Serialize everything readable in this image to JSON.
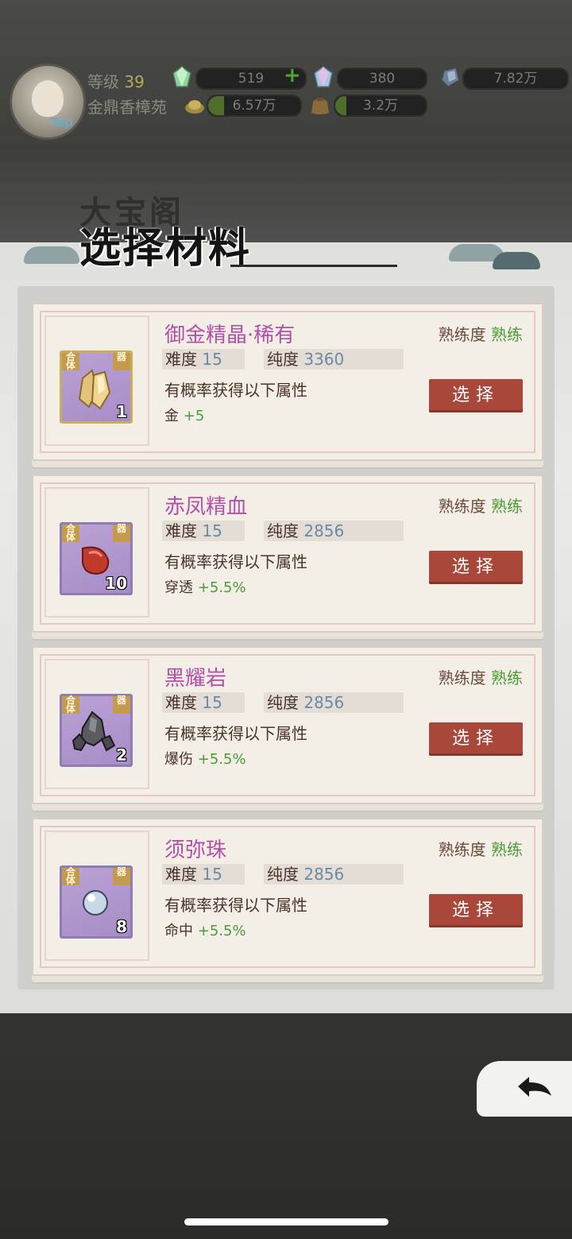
{
  "header": {
    "level_label": "等级",
    "level_value": "39",
    "place_name": "金鼎香樟苑",
    "avatar_badge": "Tap",
    "resources": [
      {
        "value": "519",
        "icon": "green-crystal-icon",
        "fill": 0
      },
      {
        "value": "380",
        "icon": "rainbow-crystal-icon",
        "fill": 0
      },
      {
        "value": "7.82万",
        "icon": "blue-ore-icon",
        "fill": 0
      },
      {
        "value": "6.57万",
        "icon": "gold-ingot-icon",
        "fill": 0.18
      },
      {
        "value": "3.2万",
        "icon": "bag-icon",
        "fill": 0.12
      }
    ],
    "plus_icon": "+"
  },
  "title": {
    "background_text": "大宝阁",
    "main_text": "选择材料"
  },
  "labels": {
    "difficulty": "难度",
    "purity": "纯度",
    "mastery": "熟练度",
    "chance_text": "有概率获得以下属性",
    "select": "选择",
    "tag_left": "合体",
    "tag_right": "器"
  },
  "materials": [
    {
      "name": "御金精晶·稀有",
      "mastery": "熟练",
      "difficulty": "15",
      "purity": "3360",
      "attr_name": "金",
      "attr_value": "+5",
      "count": "1",
      "icon": "gold-crystal-icon",
      "frame": "gold"
    },
    {
      "name": "赤凤精血",
      "mastery": "熟练",
      "difficulty": "15",
      "purity": "2856",
      "attr_name": "穿透",
      "attr_value": "+5.5%",
      "count": "10",
      "icon": "blood-drop-icon",
      "frame": "purple"
    },
    {
      "name": "黑耀岩",
      "mastery": "熟练",
      "difficulty": "15",
      "purity": "2856",
      "attr_name": "爆伤",
      "attr_value": "+5.5%",
      "count": "2",
      "icon": "obsidian-rock-icon",
      "frame": "purple"
    },
    {
      "name": "须弥珠",
      "mastery": "熟练",
      "difficulty": "15",
      "purity": "2856",
      "attr_name": "命中",
      "attr_value": "+5.5%",
      "count": "8",
      "icon": "pearl-icon",
      "frame": "purple"
    }
  ],
  "colors": {
    "name": "#b24fa8",
    "mastery_level": "#4b9b39",
    "button": "#a9483a",
    "icon_bg": "#a88cc8"
  }
}
